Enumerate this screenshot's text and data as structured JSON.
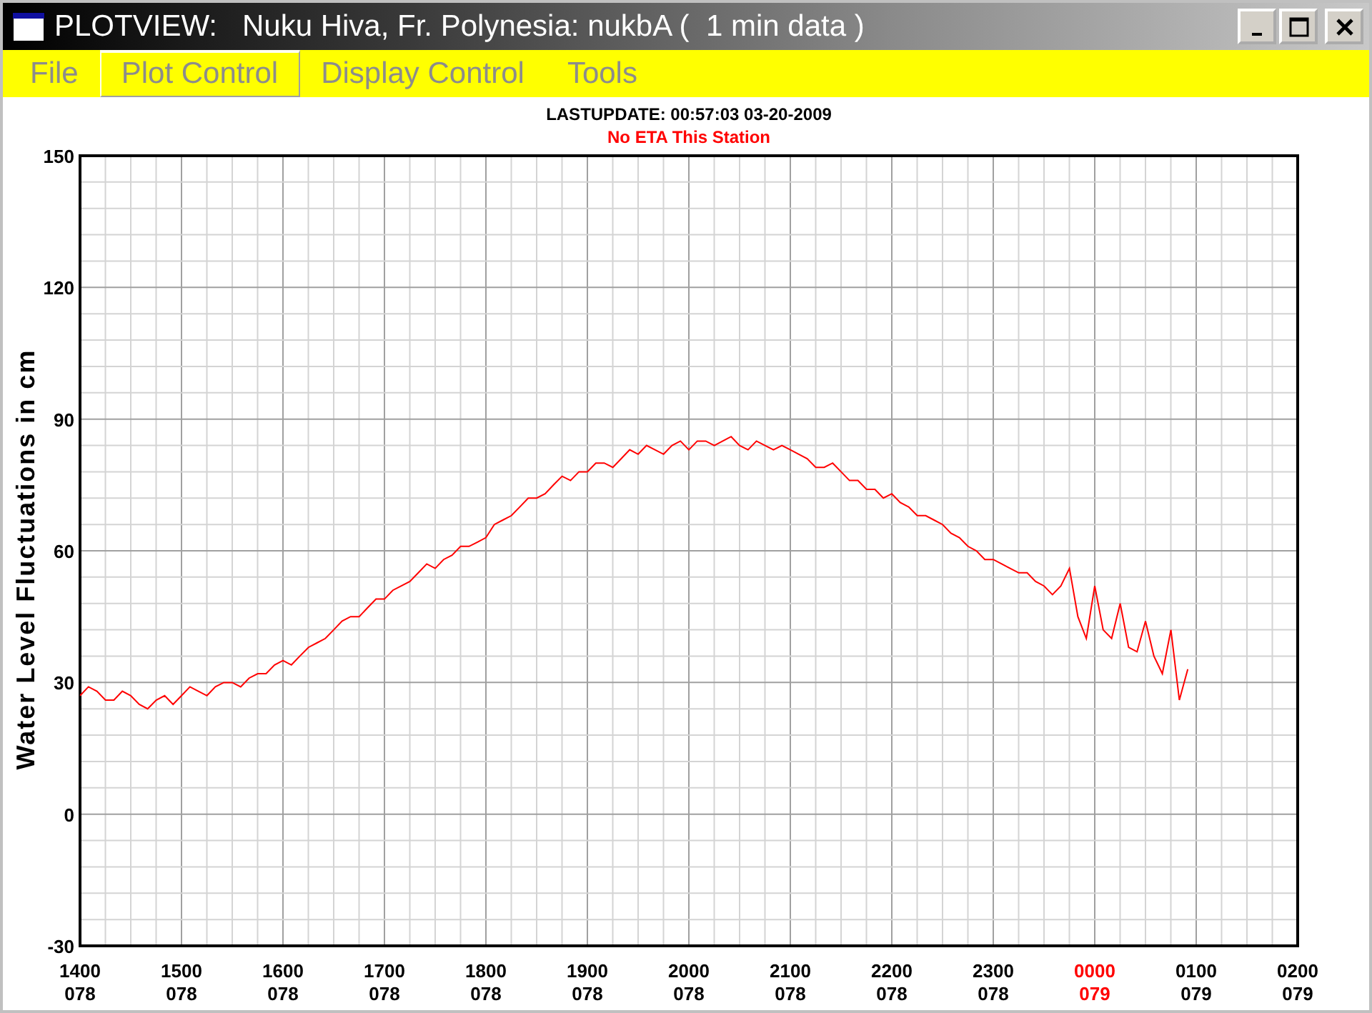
{
  "window": {
    "title": "PLOTVIEW:   Nuku Hiva, Fr. Polynesia: nukbA (  1 min data )"
  },
  "menu": [
    {
      "label": "File",
      "selected": false
    },
    {
      "label": "Plot Control",
      "selected": true
    },
    {
      "label": "Display Control",
      "selected": false
    },
    {
      "label": "Tools",
      "selected": false
    }
  ],
  "header": {
    "last_update": "LASTUPDATE: 00:57:03  03-20-2009",
    "eta_note": "No ETA This Station"
  },
  "plot": {
    "xtick_highlight": [
      false,
      false,
      false,
      false,
      false,
      false,
      false,
      false,
      false,
      false,
      true,
      false,
      false
    ],
    "chart_data": {
      "type": "line",
      "grid": true,
      "ylabel": "Water Level Fluctuations in cm",
      "ylim": [
        -30,
        150
      ],
      "yticks": [
        -30,
        0,
        30,
        60,
        90,
        120,
        150
      ],
      "categories": [
        "1400\n078",
        null,
        null,
        null,
        null,
        null,
        null,
        null,
        null,
        null,
        null,
        null,
        "1500\n078",
        null,
        null,
        null,
        null,
        null,
        null,
        null,
        null,
        null,
        null,
        null,
        "1600\n078",
        null,
        null,
        null,
        null,
        null,
        null,
        null,
        null,
        null,
        null,
        null,
        "1700\n078",
        null,
        null,
        null,
        null,
        null,
        null,
        null,
        null,
        null,
        null,
        null,
        "1800\n078",
        null,
        null,
        null,
        null,
        null,
        null,
        null,
        null,
        null,
        null,
        null,
        "1900\n078",
        null,
        null,
        null,
        null,
        null,
        null,
        null,
        null,
        null,
        null,
        null,
        "2000\n078",
        null,
        null,
        null,
        null,
        null,
        null,
        null,
        null,
        null,
        null,
        null,
        "2100\n078",
        null,
        null,
        null,
        null,
        null,
        null,
        null,
        null,
        null,
        null,
        null,
        "2200\n078",
        null,
        null,
        null,
        null,
        null,
        null,
        null,
        null,
        null,
        null,
        null,
        "2300\n078",
        null,
        null,
        null,
        null,
        null,
        null,
        null,
        null,
        null,
        null,
        null,
        "0000\n079",
        null,
        null,
        null,
        null,
        null,
        null,
        null,
        null,
        null,
        null,
        null,
        "0100\n079",
        null,
        null,
        null,
        null,
        null,
        null,
        null,
        null,
        null,
        null,
        null,
        "0200\n079"
      ],
      "series": [
        {
          "color": "#ff0000",
          "values": [
            27,
            29,
            28,
            26,
            26,
            28,
            27,
            25,
            24,
            26,
            27,
            25,
            27,
            29,
            28,
            27,
            29,
            30,
            30,
            29,
            31,
            32,
            32,
            34,
            35,
            34,
            36,
            38,
            39,
            40,
            42,
            44,
            45,
            45,
            47,
            49,
            49,
            51,
            52,
            53,
            55,
            57,
            56,
            58,
            59,
            61,
            61,
            62,
            63,
            66,
            67,
            68,
            70,
            72,
            72,
            73,
            75,
            77,
            76,
            78,
            78,
            80,
            80,
            79,
            81,
            83,
            82,
            84,
            83,
            82,
            84,
            85,
            83,
            85,
            85,
            84,
            85,
            86,
            84,
            83,
            85,
            84,
            83,
            84,
            83,
            82,
            81,
            79,
            79,
            80,
            78,
            76,
            76,
            74,
            74,
            72,
            73,
            71,
            70,
            68,
            68,
            67,
            66,
            64,
            63,
            61,
            60,
            58,
            58,
            57,
            56,
            55,
            55,
            53,
            52,
            50,
            52,
            56,
            45,
            40,
            52,
            42,
            40,
            48,
            38,
            37,
            44,
            36,
            32,
            42,
            26,
            33,
            null,
            null,
            null,
            null,
            null,
            null,
            null,
            null,
            null,
            null,
            null,
            null,
            null
          ]
        }
      ]
    }
  }
}
